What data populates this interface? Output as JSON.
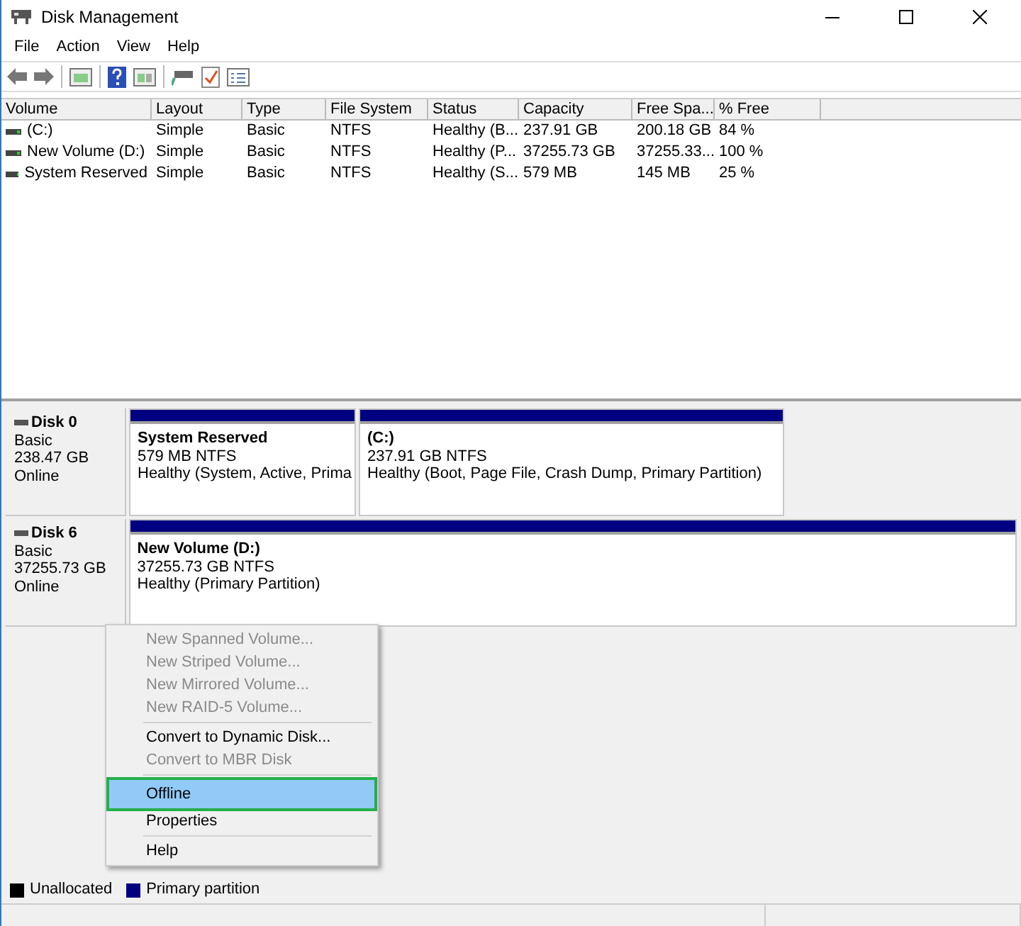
{
  "window": {
    "title": "Disk Management"
  },
  "menu_bar": [
    "File",
    "Action",
    "View",
    "Help"
  ],
  "table": {
    "columns": [
      "Volume",
      "Layout",
      "Type",
      "File System",
      "Status",
      "Capacity",
      "Free Spa...",
      "% Free"
    ],
    "rows": [
      [
        "(C:)",
        "Simple",
        "Basic",
        "NTFS",
        "Healthy (B...",
        "237.91 GB",
        "200.18 GB",
        "84 %"
      ],
      [
        "New Volume (D:)",
        "Simple",
        "Basic",
        "NTFS",
        "Healthy (P...",
        "37255.73 GB",
        "37255.33...",
        "100 %"
      ],
      [
        "System Reserved",
        "Simple",
        "Basic",
        "NTFS",
        "Healthy (S...",
        "579 MB",
        "145 MB",
        "25 %"
      ]
    ]
  },
  "disks": [
    {
      "name": "Disk 0",
      "type": "Basic",
      "size": "238.47 GB",
      "state": "Online",
      "partitions": [
        {
          "name": "System Reserved",
          "size": "579 MB NTFS",
          "status": "Healthy (System, Active, Prima"
        },
        {
          "name": "(C:)",
          "size": "237.91 GB NTFS",
          "status": "Healthy (Boot, Page File, Crash Dump, Primary Partition)"
        }
      ]
    },
    {
      "name": "Disk 6",
      "type": "Basic",
      "size": "37255.73 GB",
      "state": "Online",
      "partitions": [
        {
          "name": "New Volume  (D:)",
          "size": "37255.73 GB NTFS",
          "status": "Healthy (Primary Partition)"
        }
      ]
    }
  ],
  "legend": [
    {
      "label": "Unallocated",
      "color": "#000000"
    },
    {
      "label": "Primary partition",
      "color": "#000080"
    }
  ],
  "context_menu": [
    {
      "kind": "item",
      "label": "New Spanned Volume...",
      "disabled": true,
      "selected": false
    },
    {
      "kind": "item",
      "label": "New Striped Volume...",
      "disabled": true,
      "selected": false
    },
    {
      "kind": "item",
      "label": "New Mirrored Volume...",
      "disabled": true,
      "selected": false
    },
    {
      "kind": "item",
      "label": "New RAID-5 Volume...",
      "disabled": true,
      "selected": false
    },
    {
      "kind": "separator"
    },
    {
      "kind": "item",
      "label": "Convert to Dynamic Disk...",
      "disabled": false,
      "selected": false
    },
    {
      "kind": "item",
      "label": "Convert to MBR Disk",
      "disabled": true,
      "selected": false
    },
    {
      "kind": "separator"
    },
    {
      "kind": "item",
      "label": "Offline",
      "disabled": false,
      "selected": true
    },
    {
      "kind": "item",
      "label": "Properties",
      "disabled": false,
      "selected": false
    },
    {
      "kind": "separator"
    },
    {
      "kind": "item",
      "label": "Help",
      "disabled": false,
      "selected": false
    }
  ]
}
